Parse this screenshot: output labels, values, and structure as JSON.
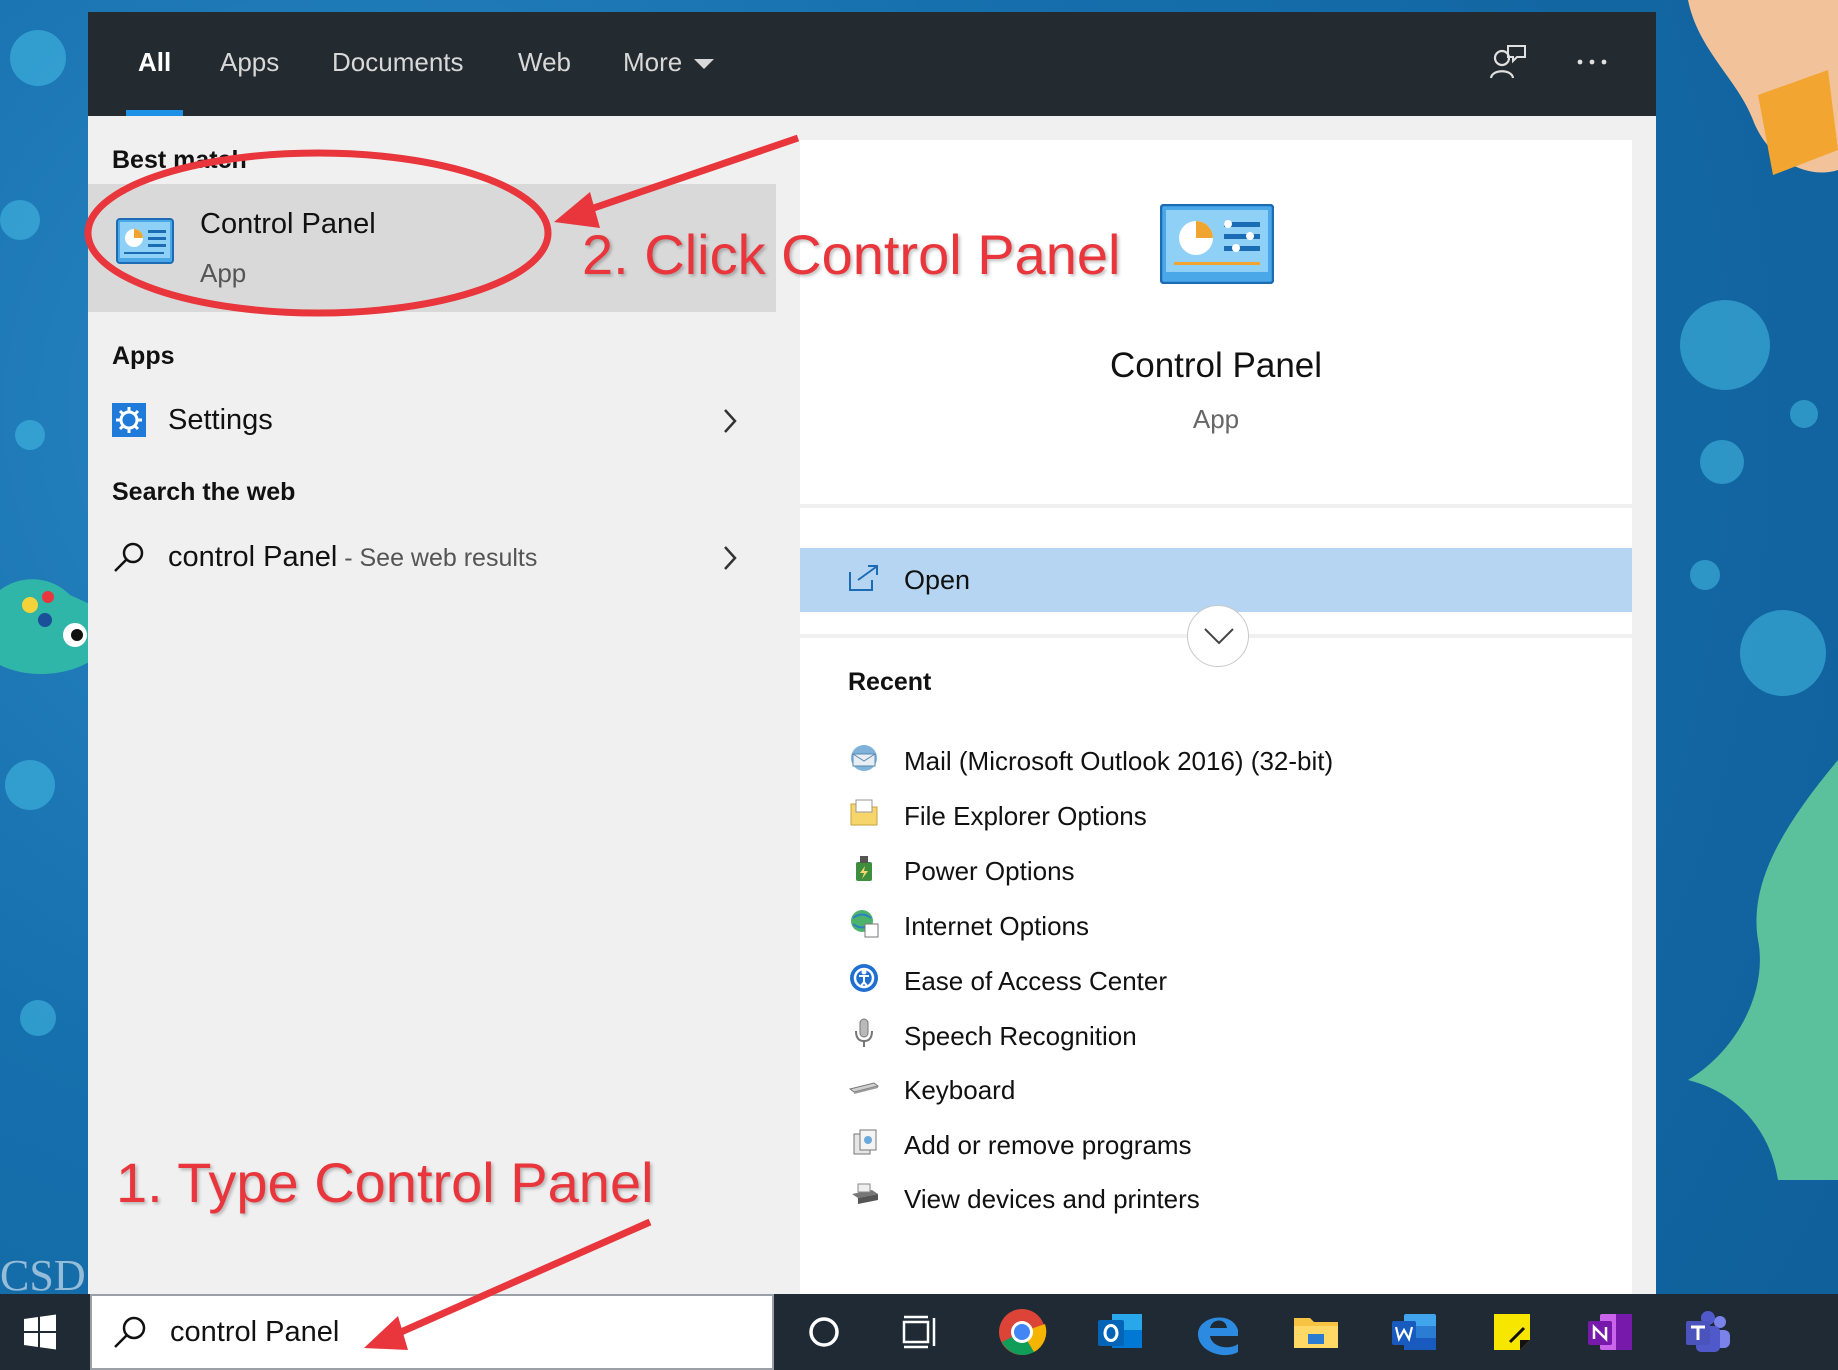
{
  "search_window": {
    "tabs": [
      {
        "label": "All",
        "active": true
      },
      {
        "label": "Apps"
      },
      {
        "label": "Documents"
      },
      {
        "label": "Web"
      },
      {
        "label": "More"
      }
    ],
    "top_icons": [
      "feedback-icon",
      "more-options-icon"
    ]
  },
  "left_pane": {
    "best_match_heading": "Best match",
    "best_match": {
      "title": "Control Panel",
      "subtitle": "App",
      "icon": "control-panel-icon"
    },
    "apps_heading": "Apps",
    "apps": [
      {
        "label": "Settings",
        "icon": "settings-gear-icon"
      }
    ],
    "web_heading": "Search the web",
    "web": [
      {
        "label": "control Panel",
        "suffix": " - See web results",
        "icon": "search-icon"
      }
    ]
  },
  "right_pane": {
    "title": "Control Panel",
    "subtitle": "App",
    "open_label": "Open",
    "recent_heading": "Recent",
    "recent": [
      {
        "label": "Mail (Microsoft Outlook 2016) (32-bit)",
        "icon": "mail-icon"
      },
      {
        "label": "File Explorer Options",
        "icon": "folder-options-icon"
      },
      {
        "label": "Power Options",
        "icon": "power-options-icon"
      },
      {
        "label": "Internet Options",
        "icon": "internet-options-icon"
      },
      {
        "label": "Ease of Access Center",
        "icon": "ease-of-access-icon"
      },
      {
        "label": "Speech Recognition",
        "icon": "microphone-icon"
      },
      {
        "label": "Keyboard",
        "icon": "keyboard-icon"
      },
      {
        "label": "Add or remove programs",
        "icon": "programs-icon"
      },
      {
        "label": "View devices and printers",
        "icon": "printer-icon"
      }
    ]
  },
  "taskbar": {
    "search_value": "control Panel",
    "apps": [
      "cortana-icon",
      "task-view-icon",
      "chrome-icon",
      "outlook-icon",
      "edge-icon",
      "file-explorer-icon",
      "word-icon",
      "sticky-notes-icon",
      "onenote-icon",
      "teams-icon"
    ]
  },
  "annotations": {
    "step1": "1. Type Control Panel",
    "step2": "2. Click Control Panel"
  },
  "desktop": {
    "watermark": "CSD"
  },
  "colors": {
    "accent": "#1e90e6",
    "annotation_red": "#e8363c",
    "header_bg": "#232a30",
    "selected_bg": "#b5d5f2",
    "taskbar_bg": "#1f2a35"
  }
}
